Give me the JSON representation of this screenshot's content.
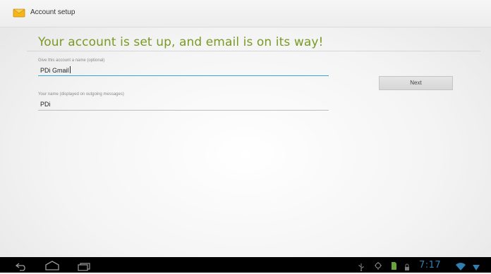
{
  "actionbar": {
    "title": "Account setup",
    "app_icon": "email-app-icon"
  },
  "main": {
    "headline": "Your account is set up, and email is on its way!",
    "account_name": {
      "label": "Give this account a name (optional)",
      "value": "PDi Gmail"
    },
    "your_name": {
      "label": "Your name (displayed on outgoing messages)",
      "value": "PDi"
    },
    "next_label": "Next"
  },
  "navbar": {
    "icons": [
      "back-icon",
      "home-icon",
      "recent-apps-icon"
    ]
  },
  "statusbar": {
    "time": "7:17",
    "icons": [
      "usb-icon",
      "usb-debug-icon",
      "sd-card-icon",
      "lock-icon",
      "wifi-icon",
      "signal-icon"
    ]
  },
  "colors": {
    "headline": "#7a9a24",
    "focus_underline": "#3aa3d9",
    "clock": "#2f7fb1"
  }
}
